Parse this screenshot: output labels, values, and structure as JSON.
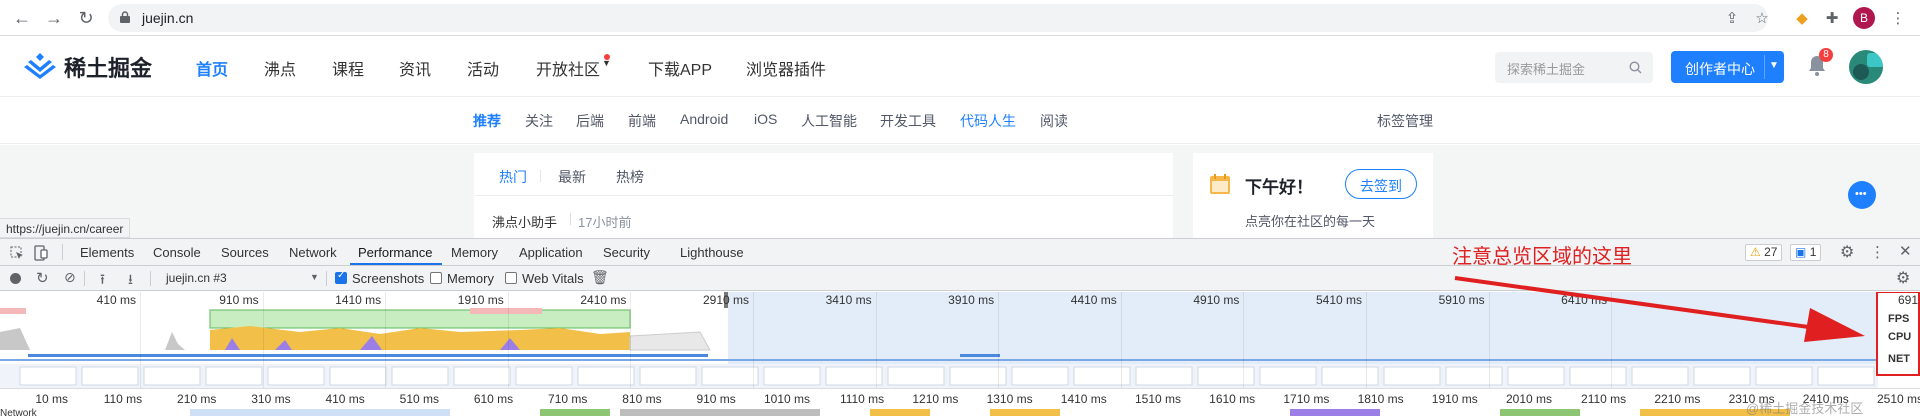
{
  "browser": {
    "url": "juejin.cn",
    "status_url": "https://juejin.cn/career",
    "profile_initial": "B"
  },
  "header": {
    "logo_text": "稀土掘金",
    "nav": [
      "首页",
      "沸点",
      "课程",
      "资讯",
      "活动",
      "开放社区",
      "下载APP",
      "浏览器插件"
    ],
    "search_placeholder": "探索稀土掘金",
    "creator_button": "创作者中心",
    "notification_count": "8"
  },
  "subnav": {
    "items": [
      "推荐",
      "关注",
      "后端",
      "前端",
      "Android",
      "iOS",
      "人工智能",
      "开发工具",
      "代码人生",
      "阅读"
    ],
    "tag_manage": "标签管理"
  },
  "feed": {
    "tabs": [
      "热门",
      "最新",
      "热榜"
    ],
    "first_item_author": "沸点小助手",
    "first_item_time": "17小时前"
  },
  "sidebar": {
    "greeting": "下午好！",
    "checkin_button": "去签到",
    "subtitle": "点亮你在社区的每一天"
  },
  "devtools": {
    "tabs": [
      "Elements",
      "Console",
      "Sources",
      "Network",
      "Performance",
      "Memory",
      "Application",
      "Security",
      "Lighthouse"
    ],
    "active_tab": "Performance",
    "warnings": "27",
    "messages": "1",
    "recording": "juejin.cn #3",
    "checkboxes": [
      {
        "label": "Screenshots",
        "checked": true
      },
      {
        "label": "Memory",
        "checked": false
      },
      {
        "label": "Web Vitals",
        "checked": false
      }
    ],
    "overview_ticks": [
      "410 ms",
      "910 ms",
      "1410 ms",
      "1910 ms",
      "2410 ms",
      "2910 ms",
      "3410 ms",
      "3910 ms",
      "4410 ms",
      "4910 ms",
      "5410 ms",
      "5910 ms",
      "6410 ms",
      "691"
    ],
    "overview_labels": [
      "FPS",
      "CPU",
      "NET"
    ],
    "flame_ticks": [
      "10 ms",
      "110 ms",
      "210 ms",
      "310 ms",
      "410 ms",
      "510 ms",
      "610 ms",
      "710 ms",
      "810 ms",
      "910 ms",
      "1010 ms",
      "1110 ms",
      "1210 ms",
      "1310 ms",
      "1410 ms",
      "1510 ms",
      "1610 ms",
      "1710 ms",
      "1810 ms",
      "1910 ms",
      "2010 ms",
      "2110 ms",
      "2210 ms",
      "2310 ms",
      "2410 ms",
      "2510 ms"
    ],
    "network_label": "Network"
  },
  "annotation": {
    "text": "注意总览区域的这里",
    "watermark": "@稀土掘金技术社区"
  },
  "colors": {
    "accent": "#1e80ff",
    "annotation": "#e02020",
    "fps": "#8ad07a",
    "cpu_scripting": "#f2c048",
    "cpu_rendering": "#9b7ee6"
  }
}
